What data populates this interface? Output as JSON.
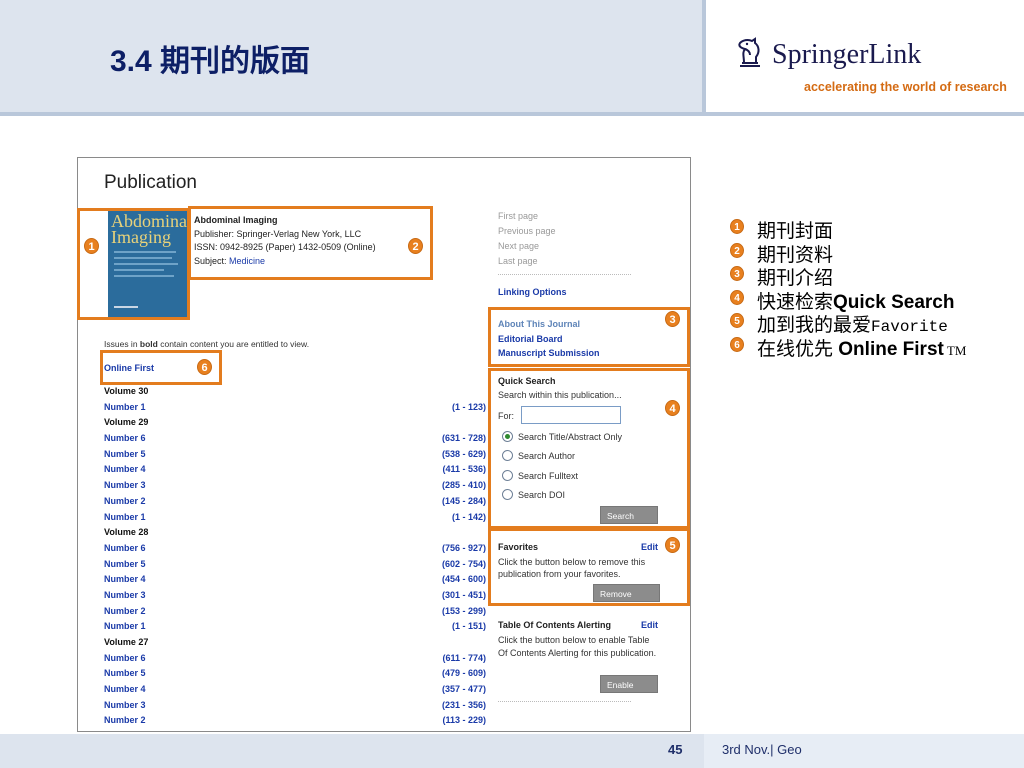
{
  "slide": {
    "title": "3.4 期刊的版面",
    "page_number": "45",
    "footer_text": "3rd  Nov.|   Geo"
  },
  "logo": {
    "name": "SpringerLink",
    "tagline": "accelerating the world of research",
    "icon": "horse-chess-icon"
  },
  "publication": {
    "heading": "Publication",
    "cover": {
      "title_line1": "Abdominal",
      "title_line2": "Imaging"
    },
    "info": {
      "name": "Abdominal Imaging",
      "publisher": "Publisher: Springer-Verlag New York, LLC",
      "issn": "ISSN: 0942-8925 (Paper) 1432-0509 (Online)",
      "subject_label": "Subject: ",
      "subject_link": "Medicine"
    },
    "issues_note_pre": "Issues in ",
    "issues_note_bold": "bold",
    "issues_note_post": " contain content you are entitled to view.",
    "online_first": "Online First",
    "volumes": [
      {
        "type": "vol",
        "label": "Volume 30",
        "range": ""
      },
      {
        "type": "num",
        "label": "Number 1",
        "range": "(1 - 123)"
      },
      {
        "type": "vol",
        "label": "Volume 29",
        "range": ""
      },
      {
        "type": "num",
        "label": "Number 6",
        "range": "(631 - 728)"
      },
      {
        "type": "num",
        "label": "Number 5",
        "range": "(538 - 629)"
      },
      {
        "type": "num",
        "label": "Number 4",
        "range": "(411 - 536)"
      },
      {
        "type": "num",
        "label": "Number 3",
        "range": "(285 - 410)"
      },
      {
        "type": "num",
        "label": "Number 2",
        "range": "(145 - 284)"
      },
      {
        "type": "num",
        "label": "Number 1",
        "range": "(1 - 142)"
      },
      {
        "type": "vol",
        "label": "Volume 28",
        "range": ""
      },
      {
        "type": "num",
        "label": "Number 6",
        "range": "(756 - 927)"
      },
      {
        "type": "num",
        "label": "Number 5",
        "range": "(602 - 754)"
      },
      {
        "type": "num",
        "label": "Number 4",
        "range": "(454 - 600)"
      },
      {
        "type": "num",
        "label": "Number 3",
        "range": "(301 - 451)"
      },
      {
        "type": "num",
        "label": "Number 2",
        "range": "(153 - 299)"
      },
      {
        "type": "num",
        "label": "Number 1",
        "range": "(1 - 151)"
      },
      {
        "type": "vol",
        "label": "Volume 27",
        "range": ""
      },
      {
        "type": "num",
        "label": "Number 6",
        "range": "(611 - 774)"
      },
      {
        "type": "num",
        "label": "Number 5",
        "range": "(479 - 609)"
      },
      {
        "type": "num",
        "label": "Number 4",
        "range": "(357 - 477)"
      },
      {
        "type": "num",
        "label": "Number 3",
        "range": "(231 - 356)"
      },
      {
        "type": "num",
        "label": "Number 2",
        "range": "(113 - 229)"
      }
    ]
  },
  "nav": {
    "first": "First page",
    "previous": "Previous page",
    "next": "Next page",
    "last": "Last page",
    "linking": "Linking Options"
  },
  "about": {
    "about_journal": "About This Journal",
    "editorial_board": "Editorial Board",
    "manuscript": "Manuscript Submission"
  },
  "quick_search": {
    "title": "Quick Search",
    "subtitle": "Search within this publication...",
    "for_label": "For:",
    "input_value": "",
    "options": [
      "Search Title/Abstract Only",
      "Search Author",
      "Search Fulltext",
      "Search DOI"
    ],
    "selected": "Search Title/Abstract Only",
    "button": "Search"
  },
  "favorites": {
    "title": "Favorites",
    "edit": "Edit",
    "text": "Click the button below to remove this publication from your favorites.",
    "button": "Remove"
  },
  "toc_alerting": {
    "title": "Table Of Contents Alerting",
    "edit": "Edit",
    "text": "Click the button below to enable Table Of Contents Alerting for this publication.",
    "button": "Enable"
  },
  "badges": [
    "1",
    "2",
    "3",
    "4",
    "5",
    "6"
  ],
  "legend": [
    {
      "num": "1",
      "text": "期刊封面"
    },
    {
      "num": "2",
      "text": "期刊资料"
    },
    {
      "num": "3",
      "text": "期刊介绍"
    },
    {
      "num": "4",
      "text": "快速检索",
      "eng": "Quick Search"
    },
    {
      "num": "5",
      "text": "加到我的最爱",
      "mono": "Favorite"
    },
    {
      "num": "6",
      "text": "在线优先 ",
      "eng": "Online First",
      "tm": " TM"
    }
  ],
  "colors": {
    "highlight": "#e37c1e",
    "title": "#0d1f66",
    "link": "#1a3aa8",
    "tagline": "#d46b13",
    "header_bg": "#dde4ee"
  }
}
